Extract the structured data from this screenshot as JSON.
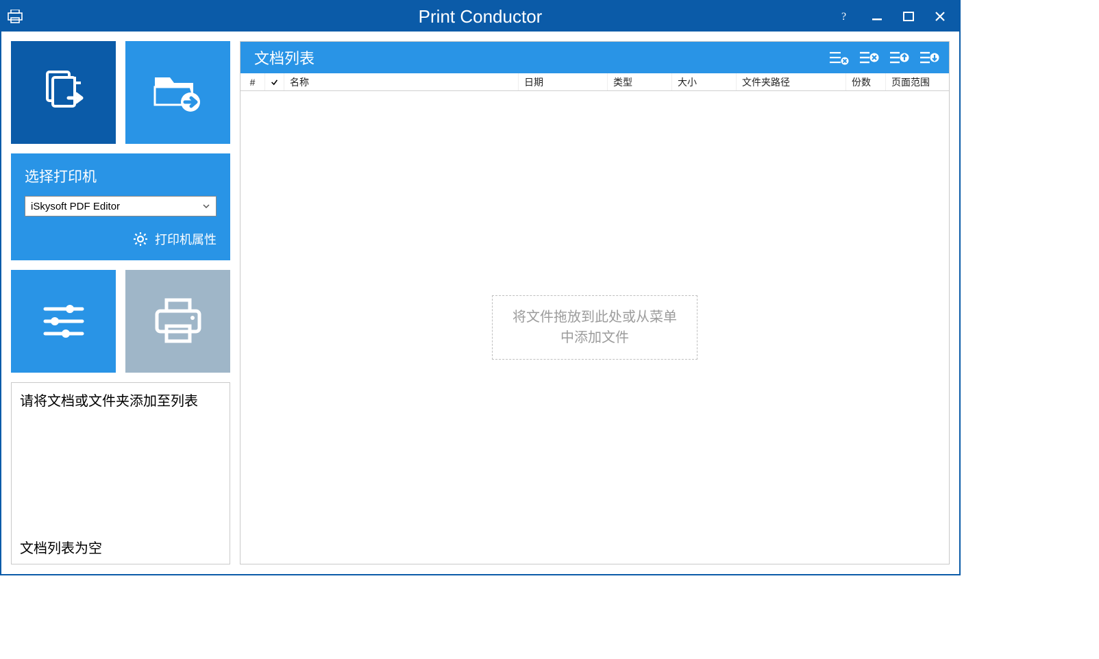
{
  "title": "Print Conductor",
  "sidebar": {
    "printer_panel_title": "选择打印机",
    "printer_selected": "iSkysoft PDF Editor",
    "printer_props": "打印机属性"
  },
  "status": {
    "instruction": "请将文档或文件夹添加至列表",
    "empty": "文档列表为空"
  },
  "main": {
    "title": "文档列表",
    "columns": {
      "num": "#",
      "name": "名称",
      "date": "日期",
      "type": "类型",
      "size": "大小",
      "path": "文件夹路径",
      "copies": "份数",
      "range": "页面范围"
    },
    "drop_hint": "将文件拖放到此处或从菜单中添加文件"
  }
}
